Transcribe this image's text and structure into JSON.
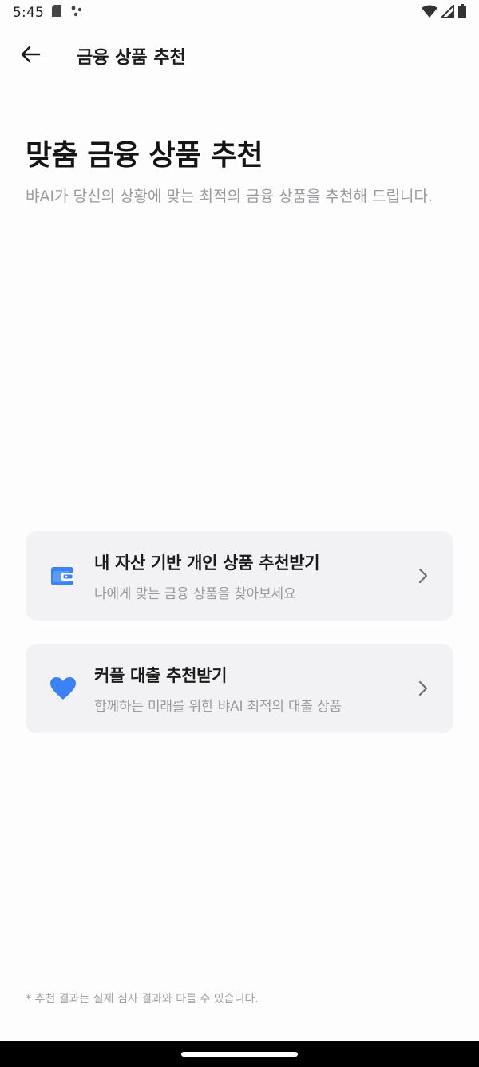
{
  "status_bar": {
    "time": "5:45",
    "icons": [
      "sd-card-icon",
      "assistant-dots-icon",
      "wifi-icon",
      "signal-icon",
      "battery-icon"
    ]
  },
  "app_bar": {
    "title": "금융 상품 추천",
    "back_icon": "arrow-left-icon"
  },
  "header": {
    "title": "맞춤 금융 상품 추천",
    "subtitle": "뱌AI가 당신의 상황에 맞는 최적의 금융 상품을 추천해 드립니다."
  },
  "options": [
    {
      "icon": "wallet-icon",
      "title": "내 자산 기반 개인 상품 추천받기",
      "description": "나에게 맞는 금융 상품을 찾아보세요"
    },
    {
      "icon": "heart-icon",
      "title": "커플 대출 추천받기",
      "description": "함께하는 미래를 위한 뱌AI 최적의 대출 상품"
    }
  ],
  "footer": {
    "note": "* 추천 결과는 실제 심사 결과와 다를 수 있습니다."
  },
  "colors": {
    "accent_blue": "#3b82f6",
    "card_background": "#f2f2f4",
    "muted_text": "#9a9a9e"
  }
}
